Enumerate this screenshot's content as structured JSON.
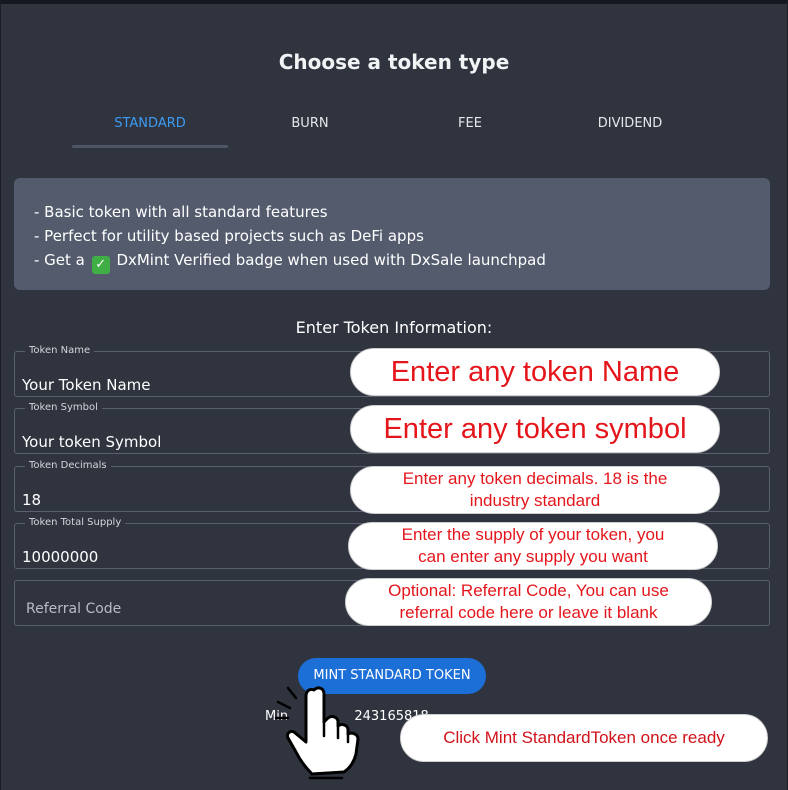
{
  "page": {
    "title": "Choose a token type"
  },
  "tabs": [
    {
      "label": "STANDARD",
      "active": true
    },
    {
      "label": "BURN",
      "active": false
    },
    {
      "label": "FEE",
      "active": false
    },
    {
      "label": "DIVIDEND",
      "active": false
    }
  ],
  "info": {
    "line1": "- Basic token with all standard features",
    "line2": "- Perfect for utility based projects such as DeFi apps",
    "line3_prefix": "- Get a",
    "line3_icon": "check-mark-icon",
    "line3_suffix": "DxMint Verified badge when used with DxSale launchpad"
  },
  "form": {
    "heading": "Enter Token Information:",
    "token_name": {
      "label": "Token Name",
      "value": "Your Token Name"
    },
    "token_symbol": {
      "label": "Token Symbol",
      "value": "Your token Symbol"
    },
    "token_decimals": {
      "label": "Token Decimals",
      "value": "18"
    },
    "token_supply": {
      "label": "Token Total Supply",
      "value": "10000000"
    },
    "referral": {
      "placeholder": "Referral Code"
    }
  },
  "callouts": {
    "name": "Enter any token Name",
    "symbol": "Enter any token symbol",
    "decimals_1": "Enter any token decimals. 18 is the",
    "decimals_2": "industry standard",
    "supply_1": "Enter the supply of your token, you",
    "supply_2": "can enter any supply you want",
    "referral_1": "Optional: Referral Code, You can use",
    "referral_2": "referral code here or leave it blank",
    "mint": "Click Mint StandardToken once ready"
  },
  "mint": {
    "button_label": "MINT STANDARD TOKEN",
    "fee_text_start": "Min",
    "fee_text_end": "243165818"
  },
  "colors": {
    "background": "#2f343f",
    "accent": "#3d9bf4",
    "button": "#1d6fd8",
    "callout_text": "#e4161c",
    "check_badge": "#3fae45"
  }
}
